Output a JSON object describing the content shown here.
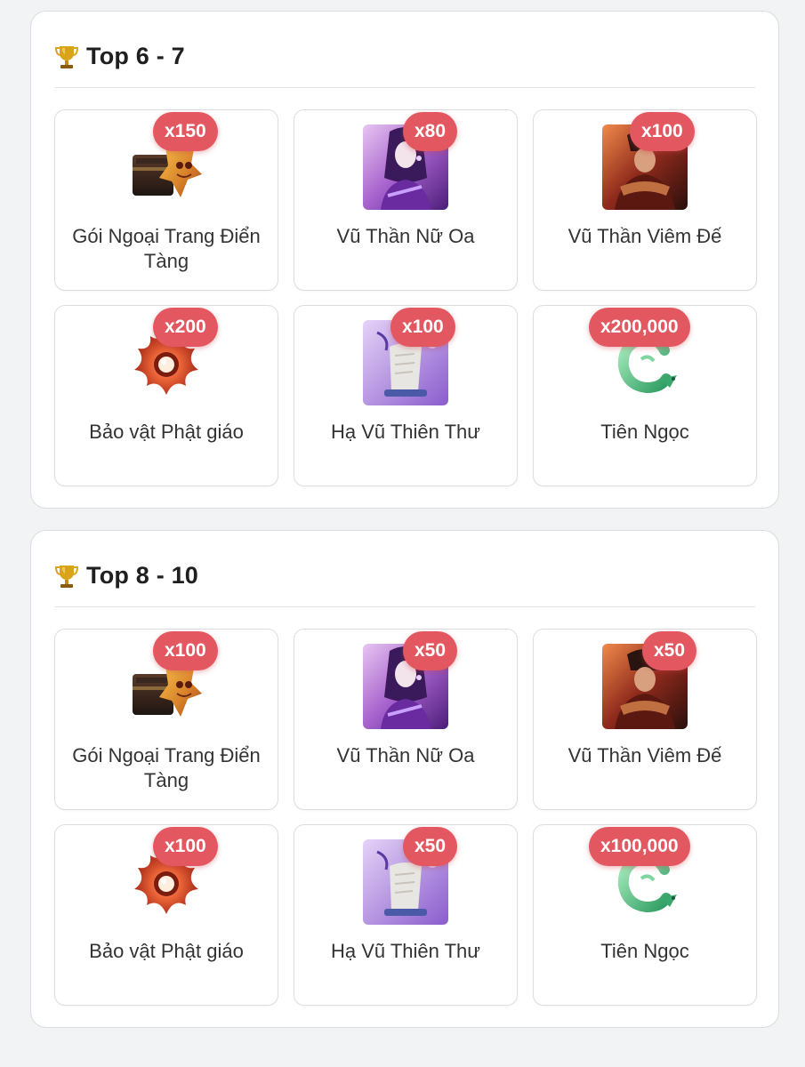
{
  "tiers": [
    {
      "title": "Top 6 - 7",
      "items": [
        {
          "name": "Gói Ngoại Trang Điển Tàng",
          "qty": "x150",
          "icon": "costume-chest-icon"
        },
        {
          "name": "Vũ Thần Nữ Oa",
          "qty": "x80",
          "icon": "nu-oa-portrait-icon"
        },
        {
          "name": "Vũ Thần Viêm Đế",
          "qty": "x100",
          "icon": "viem-de-portrait-icon"
        },
        {
          "name": "Bảo vật Phật giáo",
          "qty": "x200",
          "icon": "buddhist-relic-icon"
        },
        {
          "name": "Hạ Vũ Thiên Thư",
          "qty": "x100",
          "icon": "scroll-icon"
        },
        {
          "name": "Tiên Ngọc",
          "qty": "x200,000",
          "icon": "jade-dragon-icon"
        }
      ]
    },
    {
      "title": "Top 8 - 10",
      "items": [
        {
          "name": "Gói Ngoại Trang Điển Tàng",
          "qty": "x100",
          "icon": "costume-chest-icon"
        },
        {
          "name": "Vũ Thần Nữ Oa",
          "qty": "x50",
          "icon": "nu-oa-portrait-icon"
        },
        {
          "name": "Vũ Thần Viêm Đế",
          "qty": "x50",
          "icon": "viem-de-portrait-icon"
        },
        {
          "name": "Bảo vật Phật giáo",
          "qty": "x100",
          "icon": "buddhist-relic-icon"
        },
        {
          "name": "Hạ Vũ Thiên Thư",
          "qty": "x50",
          "icon": "scroll-icon"
        },
        {
          "name": "Tiên Ngọc",
          "qty": "x100,000",
          "icon": "jade-dragon-icon"
        }
      ]
    }
  ],
  "colors": {
    "badge": "#e35860",
    "card_border": "#dcdde1",
    "page_bg": "#f2f3f5"
  }
}
